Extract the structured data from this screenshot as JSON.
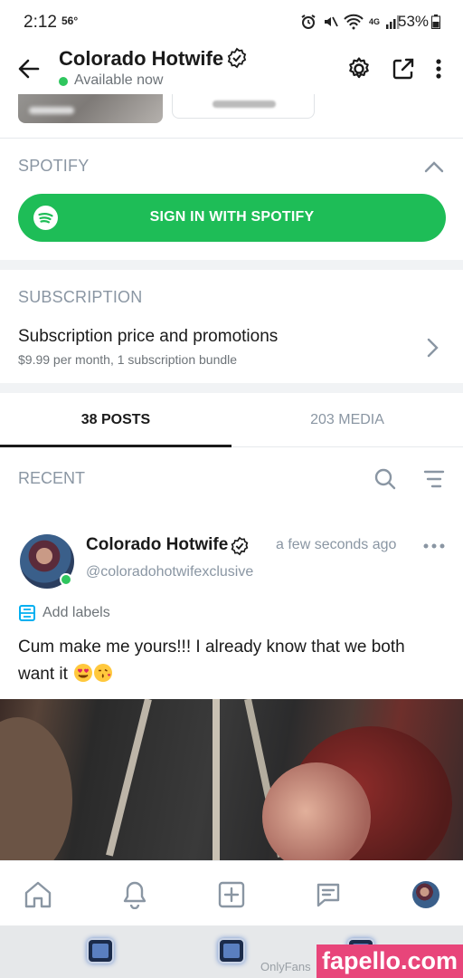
{
  "status_bar": {
    "time": "2:12",
    "temperature": "56°",
    "battery_text": "53%",
    "icons": [
      "alarm-icon",
      "mute-icon",
      "wifi-icon",
      "4g-icon",
      "signal-icon",
      "battery-icon"
    ]
  },
  "header": {
    "name": "Colorado Hotwife",
    "status": "Available now",
    "status_color": "#2fc65e",
    "icons": [
      "back-arrow-icon",
      "verified-icon",
      "settings-icon",
      "share-icon",
      "more-vertical-icon"
    ]
  },
  "spotify": {
    "section_title": "SPOTIFY",
    "button_label": "SIGN IN WITH SPOTIFY",
    "button_color": "#1ebd57"
  },
  "subscription": {
    "section_title": "SUBSCRIPTION",
    "row_title": "Subscription price and promotions",
    "row_subtitle": "$9.99 per month, 1 subscription bundle"
  },
  "tabs": [
    {
      "label": "38 POSTS",
      "active": true
    },
    {
      "label": "203 MEDIA",
      "active": false
    }
  ],
  "recent": {
    "title": "RECENT",
    "icons": [
      "search-icon",
      "sort-icon"
    ]
  },
  "post": {
    "author_name": "Colorado Hotwife",
    "timestamp": "a few seconds ago",
    "handle": "@coloradohotwifexclusive",
    "add_labels": "Add labels",
    "text": "Cum make me yours!!! I already know that we both want it",
    "emojis": [
      "heart-eyes-emoji",
      "kiss-emoji"
    ]
  },
  "bottom_nav": {
    "items": [
      "home-icon",
      "bell-icon",
      "add-post-icon",
      "messages-icon",
      "profile-avatar"
    ]
  },
  "system_bar": {
    "label": "OnlyFans"
  },
  "watermark": {
    "text": "fapello.com",
    "color": "#e8457a"
  },
  "colors": {
    "accent_blue": "#00aff0",
    "muted_text": "#8a96a3",
    "online_green": "#2fc65e"
  }
}
